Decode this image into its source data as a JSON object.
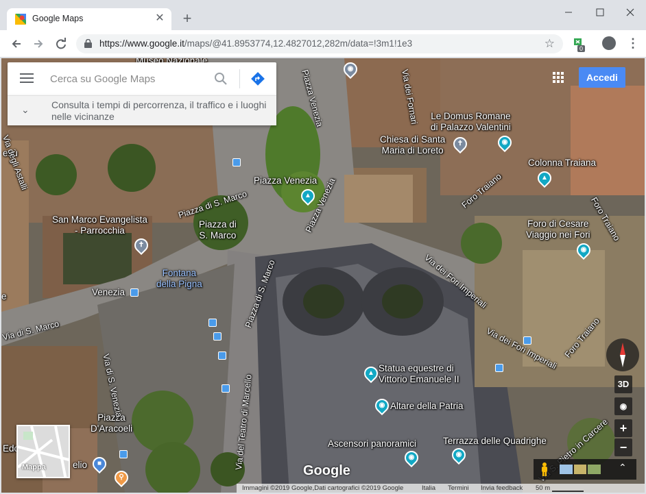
{
  "browser": {
    "tab_title": "Google Maps",
    "url_host": "https://www.google.it",
    "url_path": "/maps/@41.8953774,12.4827012,282m/data=!3m1!1e3",
    "extension_badge": "0"
  },
  "search": {
    "placeholder": "Cerca su Google Maps",
    "suggestion": "Consulta i tempi di percorrenza, il traffico e i luoghi nelle vicinanze"
  },
  "header": {
    "signin_label": "Accedi"
  },
  "places": {
    "museo": "Museo Nazionale",
    "domus_line1": "Le Domus Romane",
    "domus_line2": "di Palazzo Valentini",
    "chiesa_line1": "Chiesa di Santa",
    "chiesa_line2": "Maria di Loreto",
    "colonna": "Colonna Traiana",
    "piazza_venezia": "Piazza Venezia",
    "foro_line1": "Foro di Cesare",
    "foro_line2": "Viaggio nei Fori",
    "san_marco_line1": "San Marco Evangelista",
    "san_marco_line2": "- Parrocchia",
    "piazza_sm_line1": "Piazza di",
    "piazza_sm_line2": "S. Marco",
    "fontana_line1": "Fontana",
    "fontana_line2": "della Pigna",
    "venezia": "Venezia",
    "statua_line1": "Statua equestre di",
    "statua_line2": "Vittorio Emanuele II",
    "altare": "Altare della Patria",
    "ascensori": "Ascensori panoramici",
    "terrazza": "Terrazza delle Quadrighe",
    "aracoeli_line1": "Piazza",
    "aracoeli_line2": "D'Aracoeli",
    "edc": "Edc",
    "esu": "esù",
    "elio": "elio",
    "e": "e"
  },
  "roads": {
    "via_astalli": "Via degli Astalli",
    "via_fornari": "Via dei Fornari",
    "via_sm_1": "Piazza di S. Marco",
    "piazza_venezia_road_a": "Piazza Venezia",
    "piazza_venezia_road_b": "Piazza Venezia",
    "foro_traiano_a": "Foro Traiano",
    "foro_traiano_b": "Foro Traiano",
    "fori_imperiali_a": "Via dei Fori Imperiali",
    "fori_imperiali_b": "Via dei Fori Imperiali",
    "via_sm_2": "Via di S. Marco",
    "piazza_sm_road": "Piazza di S. Marco",
    "teatro_marcello": "Via del Teatro di Marcello",
    "via_venezia": "Via di S. Venezia",
    "via_pietro": "Via S. Pietro in Carcere",
    "fori_traiano_c": "Foro Traiano"
  },
  "controls": {
    "three_d": "3D",
    "zoom_in": "+",
    "zoom_out": "−",
    "minimap_label": "Mappa"
  },
  "branding": {
    "logo": "Google"
  },
  "footer": {
    "attribution": "Immagini ©2019 Google,Dati cartografici ©2019 Google",
    "country": "Italia",
    "terms": "Termini",
    "feedback": "Invia feedback",
    "scale": "50 m"
  },
  "colors": {
    "accent": "#4a8af4",
    "teal_pin": "#12a8c4",
    "transit": "#4a9bea"
  }
}
